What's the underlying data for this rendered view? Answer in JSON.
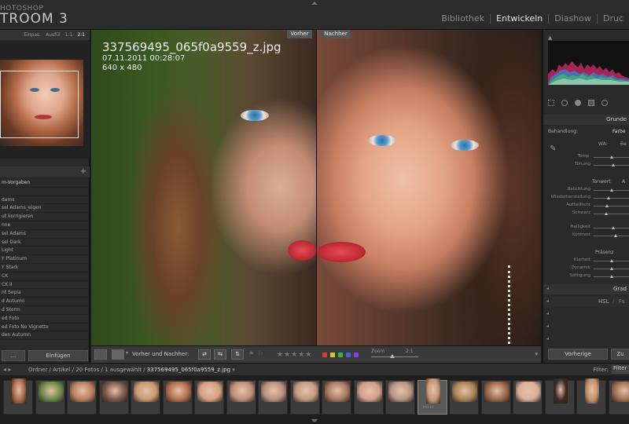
{
  "app": {
    "title_small": "HOTOSHOP",
    "title": "TROOM 3"
  },
  "modules": [
    "Bibliothek",
    "Entwickeln",
    "Diashow",
    "Druc"
  ],
  "navigator": {
    "zoom_options": [
      "Einpas.",
      "Ausfül",
      "1:1",
      "2:1"
    ],
    "active_zoom": "2:1"
  },
  "presets": {
    "add_icon": "plus-icon",
    "items": [
      "m-Vorgaben",
      "",
      "dams",
      "sel Adams_eigen",
      "ut korrigieren",
      "nne",
      "sel Adams",
      "sel Dark",
      "Light",
      "Y Platinum",
      "Y Stark",
      "CK",
      "CK II",
      "nt Sepia",
      "d Autumn",
      "d Storm",
      "ed Foto",
      "ed Foto No Vignette",
      "den Autumn"
    ]
  },
  "left_buttons": [
    "...",
    "Einfügen"
  ],
  "photo": {
    "label_before": "Vorher",
    "label_after": "Nachher",
    "filename": "337569495_065f0a9559_z.jpg",
    "date": "07.11.2011 00:28:07",
    "dimensions": "640 x 480"
  },
  "toolbar": {
    "before_after_label": "Vorher und Nachher:",
    "stars": "★★★★★",
    "color_labels": [
      "#d83a3a",
      "#d8c53a",
      "#3ab04a",
      "#3a66d8",
      "#8a3ad8"
    ],
    "zoom_label": "Zoom",
    "zoom_value": "2:1",
    "zoom_level_fraction": 0.45
  },
  "right_panel": {
    "section_basic": "Grunde",
    "treatment_label": "Behandlung:",
    "treatment_value": "Farbe",
    "wb_label": "WA:",
    "wb_value": "Be",
    "wb_sliders": [
      {
        "label": "Temp.",
        "value": 0.5
      },
      {
        "label": "Tönung",
        "value": 0.55
      }
    ],
    "tone_label": "Tonwert",
    "tone_value": "A",
    "tone_sliders": [
      {
        "label": "Belichtung",
        "value": 0.5
      },
      {
        "label": "Wiederherstellung",
        "value": 0.42
      },
      {
        "label": "Aufhelllicht",
        "value": 0.38
      },
      {
        "label": "Schwarz",
        "value": 0.35
      }
    ],
    "tone2_sliders": [
      {
        "label": "Helligkeit",
        "value": 0.55
      },
      {
        "label": "Kontrast",
        "value": 0.6
      }
    ],
    "presence_label": "Präsenz",
    "presence_sliders": [
      {
        "label": "Klarheit",
        "value": 0.5
      },
      {
        "label": "Dynamik",
        "value": 0.5
      },
      {
        "label": "Sättigung",
        "value": 0.5
      }
    ],
    "section_grad": "Grad",
    "hsl_label": "HSL",
    "hsl_sep": "/",
    "hsl_next": "Fa",
    "buttons": [
      "Vorherige",
      "Zu"
    ]
  },
  "filmstrip": {
    "path": "Ordner / Artikel / 20 Fotos / 1 ausgewählt / ",
    "current_file": "337569495_065f0a9559_z.jpg",
    "filter_label": "Filter:",
    "filter_value": "Filter",
    "thumb_count": 20,
    "selected_index": 13,
    "rated_index": 13,
    "rating_dots": "•••••"
  }
}
